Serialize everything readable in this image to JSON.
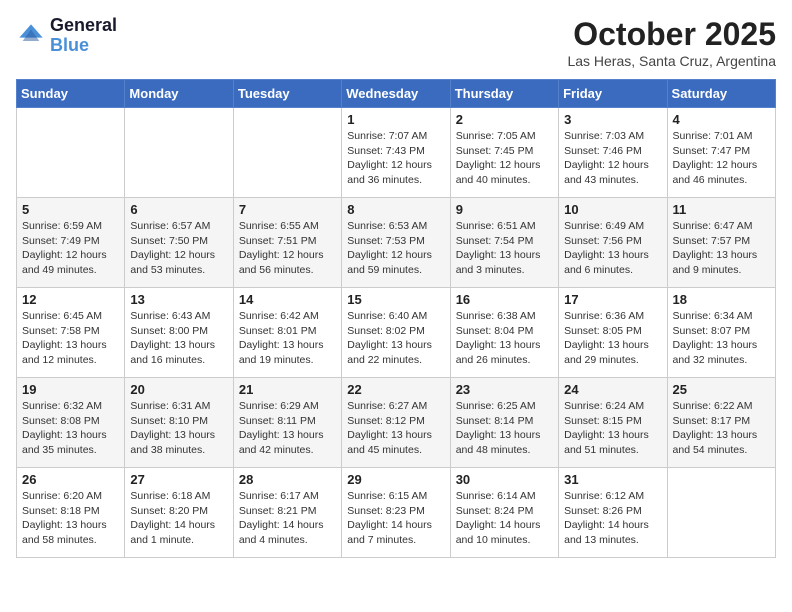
{
  "header": {
    "logo_line1": "General",
    "logo_line2": "Blue",
    "month": "October 2025",
    "location": "Las Heras, Santa Cruz, Argentina"
  },
  "weekdays": [
    "Sunday",
    "Monday",
    "Tuesday",
    "Wednesday",
    "Thursday",
    "Friday",
    "Saturday"
  ],
  "weeks": [
    [
      {
        "day": "",
        "info": ""
      },
      {
        "day": "",
        "info": ""
      },
      {
        "day": "",
        "info": ""
      },
      {
        "day": "1",
        "info": "Sunrise: 7:07 AM\nSunset: 7:43 PM\nDaylight: 12 hours\nand 36 minutes."
      },
      {
        "day": "2",
        "info": "Sunrise: 7:05 AM\nSunset: 7:45 PM\nDaylight: 12 hours\nand 40 minutes."
      },
      {
        "day": "3",
        "info": "Sunrise: 7:03 AM\nSunset: 7:46 PM\nDaylight: 12 hours\nand 43 minutes."
      },
      {
        "day": "4",
        "info": "Sunrise: 7:01 AM\nSunset: 7:47 PM\nDaylight: 12 hours\nand 46 minutes."
      }
    ],
    [
      {
        "day": "5",
        "info": "Sunrise: 6:59 AM\nSunset: 7:49 PM\nDaylight: 12 hours\nand 49 minutes."
      },
      {
        "day": "6",
        "info": "Sunrise: 6:57 AM\nSunset: 7:50 PM\nDaylight: 12 hours\nand 53 minutes."
      },
      {
        "day": "7",
        "info": "Sunrise: 6:55 AM\nSunset: 7:51 PM\nDaylight: 12 hours\nand 56 minutes."
      },
      {
        "day": "8",
        "info": "Sunrise: 6:53 AM\nSunset: 7:53 PM\nDaylight: 12 hours\nand 59 minutes."
      },
      {
        "day": "9",
        "info": "Sunrise: 6:51 AM\nSunset: 7:54 PM\nDaylight: 13 hours\nand 3 minutes."
      },
      {
        "day": "10",
        "info": "Sunrise: 6:49 AM\nSunset: 7:56 PM\nDaylight: 13 hours\nand 6 minutes."
      },
      {
        "day": "11",
        "info": "Sunrise: 6:47 AM\nSunset: 7:57 PM\nDaylight: 13 hours\nand 9 minutes."
      }
    ],
    [
      {
        "day": "12",
        "info": "Sunrise: 6:45 AM\nSunset: 7:58 PM\nDaylight: 13 hours\nand 12 minutes."
      },
      {
        "day": "13",
        "info": "Sunrise: 6:43 AM\nSunset: 8:00 PM\nDaylight: 13 hours\nand 16 minutes."
      },
      {
        "day": "14",
        "info": "Sunrise: 6:42 AM\nSunset: 8:01 PM\nDaylight: 13 hours\nand 19 minutes."
      },
      {
        "day": "15",
        "info": "Sunrise: 6:40 AM\nSunset: 8:02 PM\nDaylight: 13 hours\nand 22 minutes."
      },
      {
        "day": "16",
        "info": "Sunrise: 6:38 AM\nSunset: 8:04 PM\nDaylight: 13 hours\nand 26 minutes."
      },
      {
        "day": "17",
        "info": "Sunrise: 6:36 AM\nSunset: 8:05 PM\nDaylight: 13 hours\nand 29 minutes."
      },
      {
        "day": "18",
        "info": "Sunrise: 6:34 AM\nSunset: 8:07 PM\nDaylight: 13 hours\nand 32 minutes."
      }
    ],
    [
      {
        "day": "19",
        "info": "Sunrise: 6:32 AM\nSunset: 8:08 PM\nDaylight: 13 hours\nand 35 minutes."
      },
      {
        "day": "20",
        "info": "Sunrise: 6:31 AM\nSunset: 8:10 PM\nDaylight: 13 hours\nand 38 minutes."
      },
      {
        "day": "21",
        "info": "Sunrise: 6:29 AM\nSunset: 8:11 PM\nDaylight: 13 hours\nand 42 minutes."
      },
      {
        "day": "22",
        "info": "Sunrise: 6:27 AM\nSunset: 8:12 PM\nDaylight: 13 hours\nand 45 minutes."
      },
      {
        "day": "23",
        "info": "Sunrise: 6:25 AM\nSunset: 8:14 PM\nDaylight: 13 hours\nand 48 minutes."
      },
      {
        "day": "24",
        "info": "Sunrise: 6:24 AM\nSunset: 8:15 PM\nDaylight: 13 hours\nand 51 minutes."
      },
      {
        "day": "25",
        "info": "Sunrise: 6:22 AM\nSunset: 8:17 PM\nDaylight: 13 hours\nand 54 minutes."
      }
    ],
    [
      {
        "day": "26",
        "info": "Sunrise: 6:20 AM\nSunset: 8:18 PM\nDaylight: 13 hours\nand 58 minutes."
      },
      {
        "day": "27",
        "info": "Sunrise: 6:18 AM\nSunset: 8:20 PM\nDaylight: 14 hours\nand 1 minute."
      },
      {
        "day": "28",
        "info": "Sunrise: 6:17 AM\nSunset: 8:21 PM\nDaylight: 14 hours\nand 4 minutes."
      },
      {
        "day": "29",
        "info": "Sunrise: 6:15 AM\nSunset: 8:23 PM\nDaylight: 14 hours\nand 7 minutes."
      },
      {
        "day": "30",
        "info": "Sunrise: 6:14 AM\nSunset: 8:24 PM\nDaylight: 14 hours\nand 10 minutes."
      },
      {
        "day": "31",
        "info": "Sunrise: 6:12 AM\nSunset: 8:26 PM\nDaylight: 14 hours\nand 13 minutes."
      },
      {
        "day": "",
        "info": ""
      }
    ]
  ]
}
